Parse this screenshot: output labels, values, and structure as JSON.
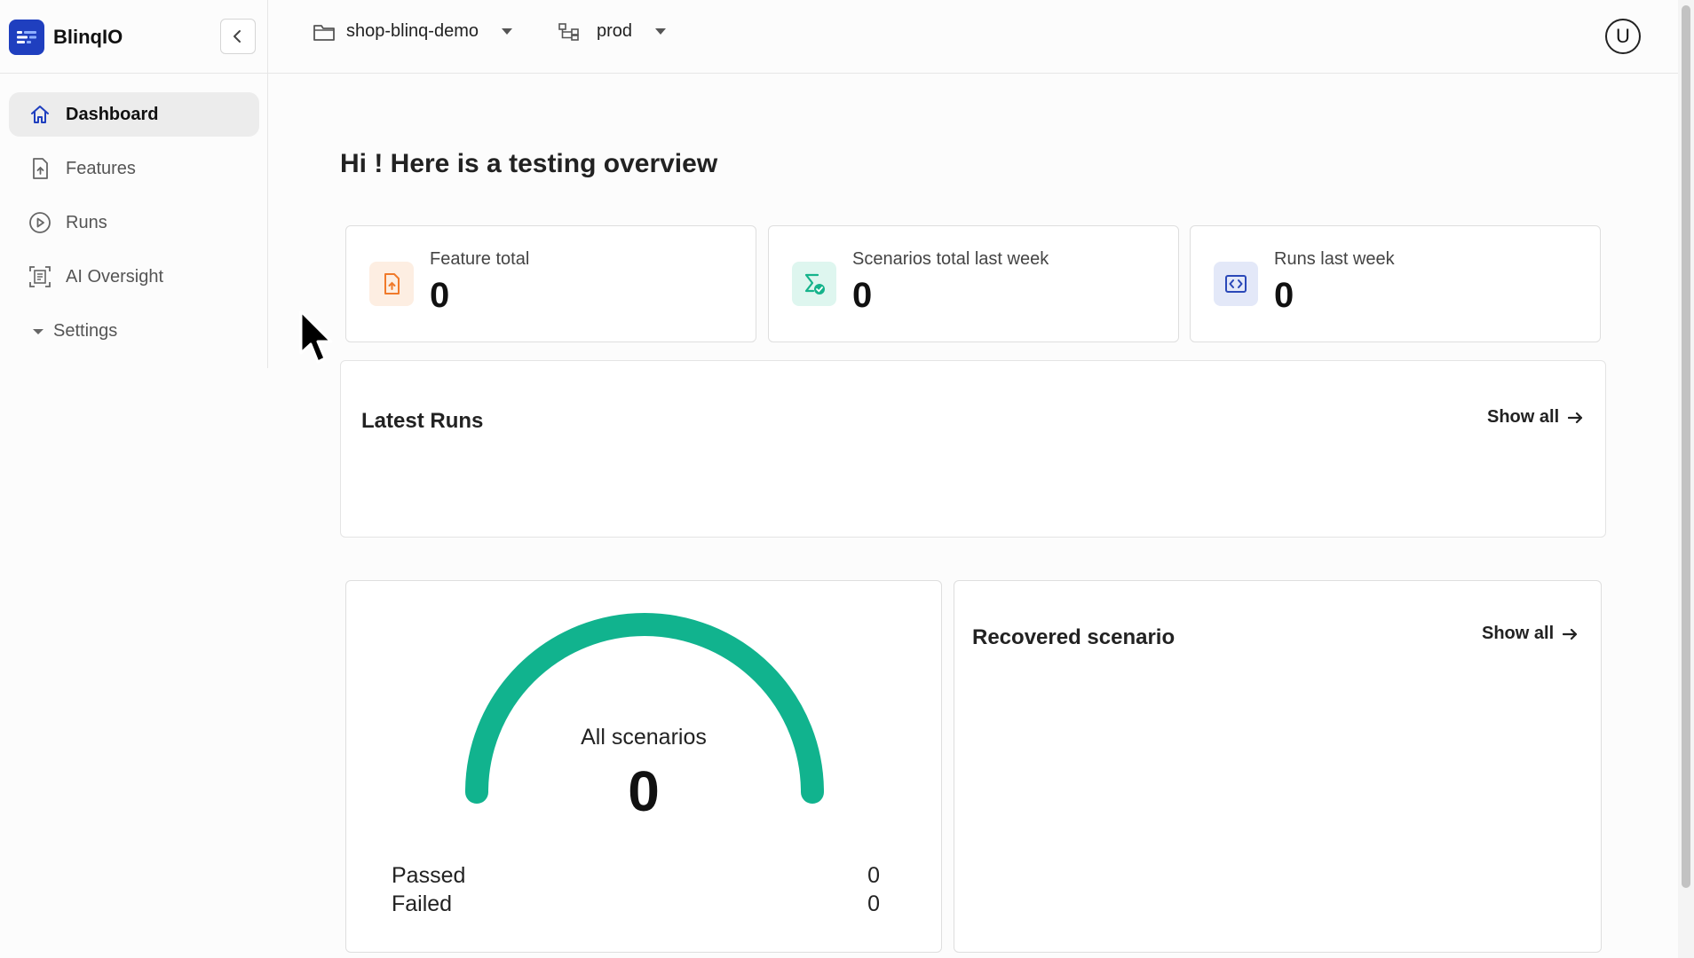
{
  "brand": {
    "name": "BlinqIO"
  },
  "header": {
    "project": "shop-blinq-demo",
    "environment": "prod",
    "avatar_letter": "U"
  },
  "sidebar": {
    "items": [
      {
        "label": "Dashboard",
        "icon": "home-icon",
        "active": true
      },
      {
        "label": "Features",
        "icon": "file-icon",
        "active": false
      },
      {
        "label": "Runs",
        "icon": "play-circle-icon",
        "active": false
      },
      {
        "label": "AI Oversight",
        "icon": "scan-icon",
        "active": false
      },
      {
        "label": "Settings",
        "icon": "caret-down-icon",
        "active": false
      }
    ]
  },
  "main": {
    "greeting": "Hi ! Here is a testing overview",
    "stats": [
      {
        "label": "Feature total",
        "value": "0",
        "icon": "file-upload-icon",
        "color": "#f07a2b"
      },
      {
        "label": "Scenarios total last week",
        "value": "0",
        "icon": "sigma-check-icon",
        "color": "#15b38b"
      },
      {
        "label": "Runs last week",
        "value": "0",
        "icon": "code-window-icon",
        "color": "#2a48b8"
      }
    ],
    "latest_runs": {
      "title": "Latest Runs",
      "show_all": "Show all"
    },
    "gauge": {
      "label": "All scenarios",
      "value": "0",
      "color": "#11b38e",
      "passed_label": "Passed",
      "passed_value": "0",
      "failed_label": "Failed",
      "failed_value": "0"
    },
    "recovered": {
      "title": "Recovered scenario",
      "show_all": "Show all"
    }
  }
}
